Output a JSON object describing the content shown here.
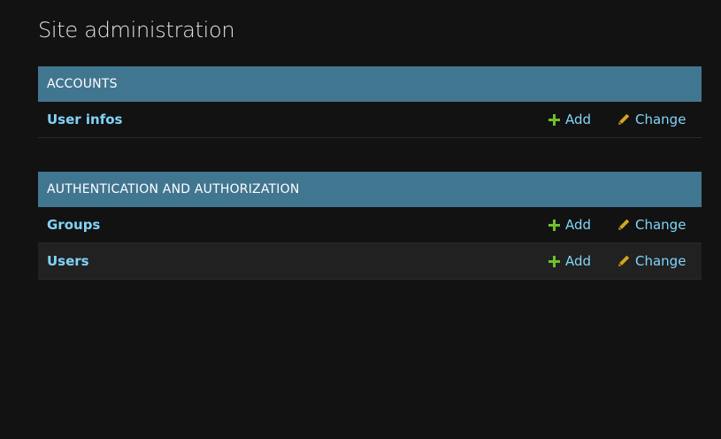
{
  "page": {
    "title": "Site administration"
  },
  "modules": [
    {
      "header": "ACCOUNTS",
      "rows": [
        {
          "name": "User infos",
          "add_label": "Add",
          "change_label": "Change"
        }
      ]
    },
    {
      "header": "AUTHENTICATION AND AUTHORIZATION",
      "rows": [
        {
          "name": "Groups",
          "add_label": "Add",
          "change_label": "Change"
        },
        {
          "name": "Users",
          "add_label": "Add",
          "change_label": "Change"
        }
      ]
    }
  ],
  "colors": {
    "background": "#121212",
    "header_bg": "#417690",
    "link": "#81d4fa",
    "add_icon": "#70bf2b",
    "change_icon": "#d4a61f"
  },
  "icons": {
    "add": "plus-icon",
    "change": "pencil-icon"
  }
}
